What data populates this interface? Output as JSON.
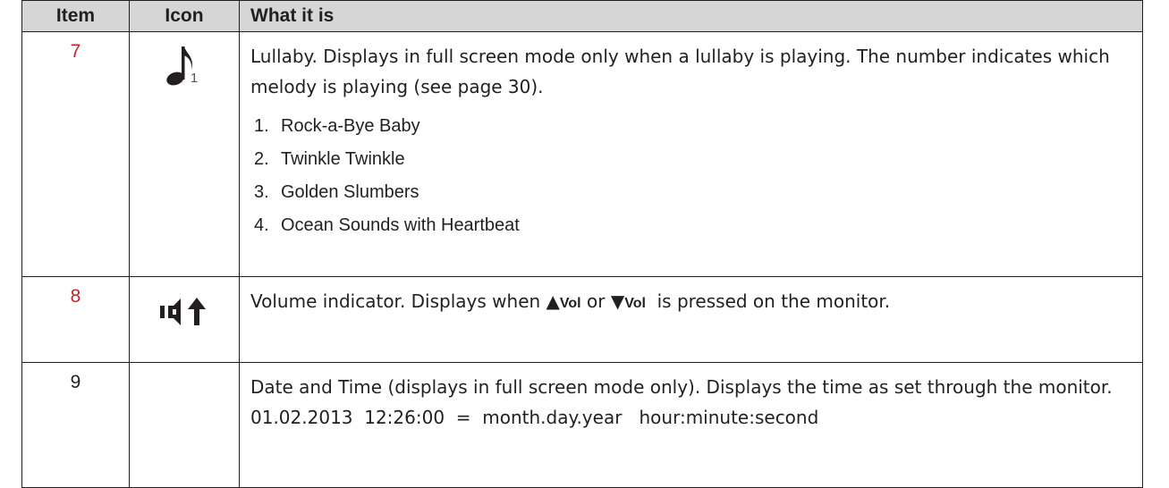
{
  "table": {
    "headers": {
      "item": "Item",
      "icon": "Icon",
      "what": "What it is"
    },
    "rows": [
      {
        "item": "7",
        "icon": "music-note-icon",
        "icon_sub": "1",
        "desc": "Lullaby.  Displays in full screen mode only when a lullaby is playing. The number indicates which melody is playing (see page 30).",
        "list": [
          {
            "n": "1.",
            "text": "Rock-a-Bye Baby"
          },
          {
            "n": "2.",
            "text": "Twinkle Twinkle"
          },
          {
            "n": "3.",
            "text": "Golden Slumbers"
          },
          {
            "n": "4.",
            "text": "Ocean Sounds with Heartbeat"
          }
        ]
      },
      {
        "item": "8",
        "icon": "volume-up-icon",
        "desc_a": "Volume indicator. Displays when ",
        "up_symbol": "▲",
        "vol_a": "Vol",
        "or": " or ",
        "down_symbol": "▼",
        "vol_b": "Vol",
        "desc_b": "  is pressed on the monitor."
      },
      {
        "item": "9",
        "desc": "Date and Time (displays in full screen mode only).  Displays the time as set through the monitor.",
        "example": "01.02.2013  12:26:00  =  month.day.year   hour:minute:second"
      }
    ]
  },
  "colors": {
    "item_red": "#c0272d",
    "header_bg": "#d6d6d6",
    "border": "#231f20"
  }
}
